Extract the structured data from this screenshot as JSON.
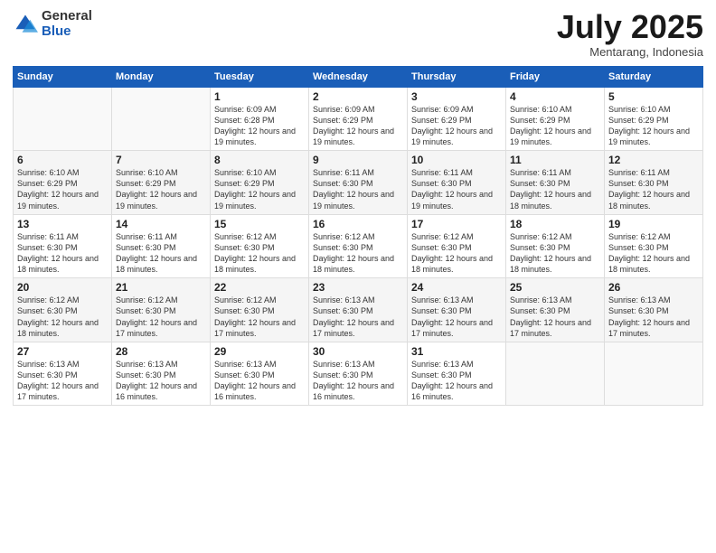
{
  "logo": {
    "general": "General",
    "blue": "Blue"
  },
  "header": {
    "month": "July 2025",
    "location": "Mentarang, Indonesia"
  },
  "weekdays": [
    "Sunday",
    "Monday",
    "Tuesday",
    "Wednesday",
    "Thursday",
    "Friday",
    "Saturday"
  ],
  "weeks": [
    [
      {
        "day": "",
        "info": ""
      },
      {
        "day": "",
        "info": ""
      },
      {
        "day": "1",
        "info": "Sunrise: 6:09 AM\nSunset: 6:28 PM\nDaylight: 12 hours and 19 minutes."
      },
      {
        "day": "2",
        "info": "Sunrise: 6:09 AM\nSunset: 6:29 PM\nDaylight: 12 hours and 19 minutes."
      },
      {
        "day": "3",
        "info": "Sunrise: 6:09 AM\nSunset: 6:29 PM\nDaylight: 12 hours and 19 minutes."
      },
      {
        "day": "4",
        "info": "Sunrise: 6:10 AM\nSunset: 6:29 PM\nDaylight: 12 hours and 19 minutes."
      },
      {
        "day": "5",
        "info": "Sunrise: 6:10 AM\nSunset: 6:29 PM\nDaylight: 12 hours and 19 minutes."
      }
    ],
    [
      {
        "day": "6",
        "info": "Sunrise: 6:10 AM\nSunset: 6:29 PM\nDaylight: 12 hours and 19 minutes."
      },
      {
        "day": "7",
        "info": "Sunrise: 6:10 AM\nSunset: 6:29 PM\nDaylight: 12 hours and 19 minutes."
      },
      {
        "day": "8",
        "info": "Sunrise: 6:10 AM\nSunset: 6:29 PM\nDaylight: 12 hours and 19 minutes."
      },
      {
        "day": "9",
        "info": "Sunrise: 6:11 AM\nSunset: 6:30 PM\nDaylight: 12 hours and 19 minutes."
      },
      {
        "day": "10",
        "info": "Sunrise: 6:11 AM\nSunset: 6:30 PM\nDaylight: 12 hours and 19 minutes."
      },
      {
        "day": "11",
        "info": "Sunrise: 6:11 AM\nSunset: 6:30 PM\nDaylight: 12 hours and 18 minutes."
      },
      {
        "day": "12",
        "info": "Sunrise: 6:11 AM\nSunset: 6:30 PM\nDaylight: 12 hours and 18 minutes."
      }
    ],
    [
      {
        "day": "13",
        "info": "Sunrise: 6:11 AM\nSunset: 6:30 PM\nDaylight: 12 hours and 18 minutes."
      },
      {
        "day": "14",
        "info": "Sunrise: 6:11 AM\nSunset: 6:30 PM\nDaylight: 12 hours and 18 minutes."
      },
      {
        "day": "15",
        "info": "Sunrise: 6:12 AM\nSunset: 6:30 PM\nDaylight: 12 hours and 18 minutes."
      },
      {
        "day": "16",
        "info": "Sunrise: 6:12 AM\nSunset: 6:30 PM\nDaylight: 12 hours and 18 minutes."
      },
      {
        "day": "17",
        "info": "Sunrise: 6:12 AM\nSunset: 6:30 PM\nDaylight: 12 hours and 18 minutes."
      },
      {
        "day": "18",
        "info": "Sunrise: 6:12 AM\nSunset: 6:30 PM\nDaylight: 12 hours and 18 minutes."
      },
      {
        "day": "19",
        "info": "Sunrise: 6:12 AM\nSunset: 6:30 PM\nDaylight: 12 hours and 18 minutes."
      }
    ],
    [
      {
        "day": "20",
        "info": "Sunrise: 6:12 AM\nSunset: 6:30 PM\nDaylight: 12 hours and 18 minutes."
      },
      {
        "day": "21",
        "info": "Sunrise: 6:12 AM\nSunset: 6:30 PM\nDaylight: 12 hours and 17 minutes."
      },
      {
        "day": "22",
        "info": "Sunrise: 6:12 AM\nSunset: 6:30 PM\nDaylight: 12 hours and 17 minutes."
      },
      {
        "day": "23",
        "info": "Sunrise: 6:13 AM\nSunset: 6:30 PM\nDaylight: 12 hours and 17 minutes."
      },
      {
        "day": "24",
        "info": "Sunrise: 6:13 AM\nSunset: 6:30 PM\nDaylight: 12 hours and 17 minutes."
      },
      {
        "day": "25",
        "info": "Sunrise: 6:13 AM\nSunset: 6:30 PM\nDaylight: 12 hours and 17 minutes."
      },
      {
        "day": "26",
        "info": "Sunrise: 6:13 AM\nSunset: 6:30 PM\nDaylight: 12 hours and 17 minutes."
      }
    ],
    [
      {
        "day": "27",
        "info": "Sunrise: 6:13 AM\nSunset: 6:30 PM\nDaylight: 12 hours and 17 minutes."
      },
      {
        "day": "28",
        "info": "Sunrise: 6:13 AM\nSunset: 6:30 PM\nDaylight: 12 hours and 16 minutes."
      },
      {
        "day": "29",
        "info": "Sunrise: 6:13 AM\nSunset: 6:30 PM\nDaylight: 12 hours and 16 minutes."
      },
      {
        "day": "30",
        "info": "Sunrise: 6:13 AM\nSunset: 6:30 PM\nDaylight: 12 hours and 16 minutes."
      },
      {
        "day": "31",
        "info": "Sunrise: 6:13 AM\nSunset: 6:30 PM\nDaylight: 12 hours and 16 minutes."
      },
      {
        "day": "",
        "info": ""
      },
      {
        "day": "",
        "info": ""
      }
    ]
  ]
}
